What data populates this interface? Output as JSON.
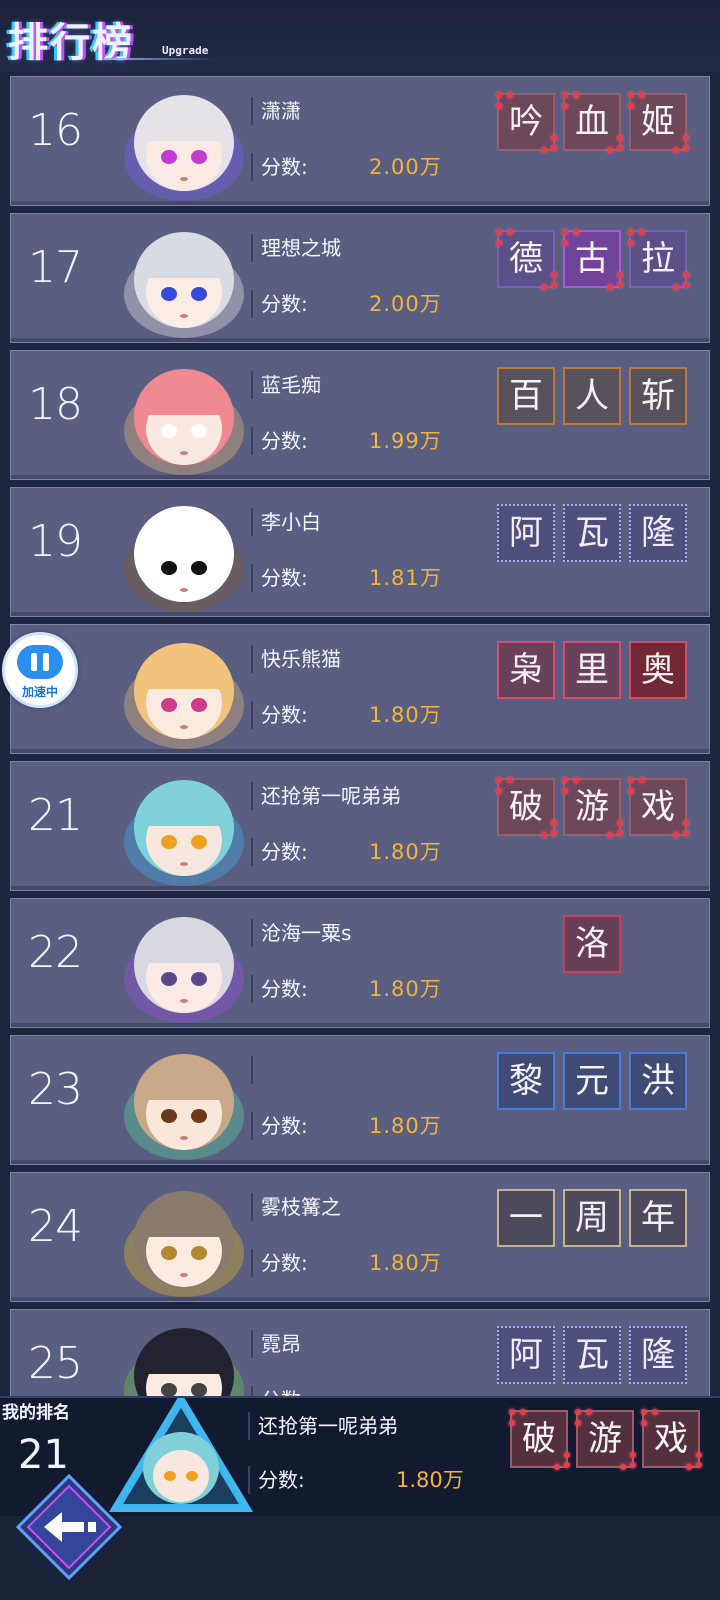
{
  "header": {
    "title": "排行榜",
    "subtitle": "Upgrade"
  },
  "score_label": "分数:",
  "rows": [
    {
      "rank": "16",
      "name": "潇潇",
      "score": "2.00万",
      "badges": [
        "吟",
        "血",
        "姬"
      ],
      "badge_style": "red"
    },
    {
      "rank": "17",
      "name": "理想之城",
      "score": "2.00万",
      "badges": [
        "德",
        "古",
        "拉"
      ],
      "badge_style": "purple"
    },
    {
      "rank": "18",
      "name": "蓝毛痴",
      "score": "1.99万",
      "badges": [
        "百",
        "人",
        "斩"
      ],
      "badge_style": "orange"
    },
    {
      "rank": "19",
      "name": "李小白",
      "score": "1.81万",
      "badges": [
        "阿",
        "瓦",
        "隆"
      ],
      "badge_style": "pac"
    },
    {
      "rank": "",
      "name": "快乐熊猫",
      "score": "1.80万",
      "badges": [
        "枭",
        "里",
        "奥"
      ],
      "badge_style": "pink"
    },
    {
      "rank": "21",
      "name": "还抢第一呢弟弟",
      "score": "1.80万",
      "badges": [
        "破",
        "游",
        "戏"
      ],
      "badge_style": "red"
    },
    {
      "rank": "22",
      "name": "沧海一粟s",
      "score": "1.80万",
      "badges": [
        "洛"
      ],
      "badge_style": "single"
    },
    {
      "rank": "23",
      "name": "",
      "score": "1.80万",
      "badges": [
        "黎",
        "元",
        "洪"
      ],
      "badge_style": "blue"
    },
    {
      "rank": "24",
      "name": "雾枝篝之",
      "score": "1.80万",
      "badges": [
        "一",
        "周",
        "年"
      ],
      "badge_style": "sparkle"
    },
    {
      "rank": "25",
      "name": "霓昂",
      "score": "",
      "badges": [
        "阿",
        "瓦",
        "隆"
      ],
      "badge_style": "pac"
    }
  ],
  "speed_button": {
    "label": "加速中"
  },
  "my_rank": {
    "label": "我的排名",
    "rank": "21",
    "name": "还抢第一呢弟弟",
    "score": "1.80万",
    "badges": [
      "破",
      "游",
      "戏"
    ]
  },
  "colors": {
    "score": "#f3b43c",
    "row_bg": "#5a5f82",
    "page_bg": "#1d2540"
  }
}
